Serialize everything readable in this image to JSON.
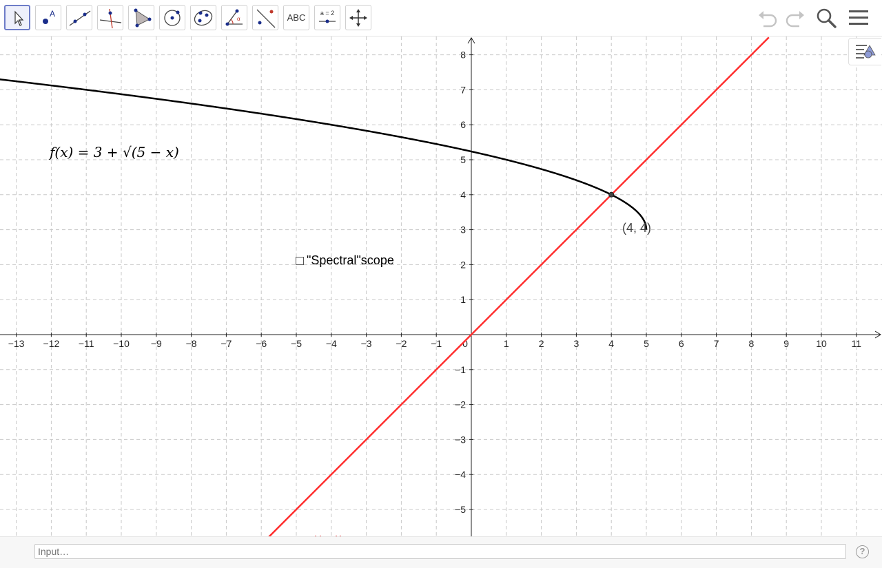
{
  "toolbar": {
    "tools": [
      {
        "name": "move",
        "icon": "cursor-arrow-icon"
      },
      {
        "name": "point",
        "icon": "point-icon"
      },
      {
        "name": "line",
        "icon": "line-through-two-points-icon"
      },
      {
        "name": "perpendicular",
        "icon": "perpendicular-line-icon"
      },
      {
        "name": "polygon",
        "icon": "polygon-icon"
      },
      {
        "name": "circle",
        "icon": "circle-center-point-icon"
      },
      {
        "name": "conic",
        "icon": "ellipse-icon"
      },
      {
        "name": "angle",
        "icon": "angle-icon"
      },
      {
        "name": "reflect",
        "icon": "reflect-about-line-icon"
      },
      {
        "name": "text",
        "label": "ABC"
      },
      {
        "name": "slider",
        "label": "a = 2"
      },
      {
        "name": "move-graphics",
        "icon": "move-view-icon"
      }
    ],
    "right_icons": [
      "undo-icon",
      "redo-icon",
      "search-icon",
      "menu-icon"
    ]
  },
  "graphics": {
    "x_ticks": [
      "−13",
      "−12",
      "−11",
      "−10",
      "−9",
      "−8",
      "−7",
      "−6",
      "−5",
      "−4",
      "−3",
      "−2",
      "−1",
      "0",
      "1",
      "2",
      "3",
      "4",
      "5",
      "6",
      "7",
      "8",
      "9",
      "10",
      "11"
    ],
    "y_ticks": [
      "−5",
      "−4",
      "−3",
      "−2",
      "−1",
      "1",
      "2",
      "3",
      "4",
      "5",
      "6",
      "7",
      "8"
    ],
    "function_label": "f(x) = 3 + √(5 − x)",
    "point_label": "(4, 4)",
    "line_label": "y = x",
    "checkbox_label": "\"Spectral\"scope",
    "colors": {
      "line": "#ff2d2d",
      "curve": "#000000",
      "grid": "#c8c8c8",
      "point": "#444444"
    }
  },
  "chart_data": {
    "type": "line",
    "title": "",
    "xlim": [
      -13.6,
      11.7
    ],
    "ylim": [
      -5.8,
      8.5
    ],
    "grid": true,
    "series": [
      {
        "name": "f(x) = 3 + √(5 − x)",
        "formula": "3+sqrt(5-x)",
        "domain": [
          -13.6,
          5
        ],
        "x": [
          -13.6,
          -10,
          -5,
          -1,
          0,
          2,
          4,
          4.5,
          5
        ],
        "values": [
          7.31,
          6.87,
          6.16,
          5.45,
          5.24,
          4.73,
          4.0,
          3.71,
          3.0
        ]
      },
      {
        "name": "y = x",
        "formula": "x",
        "x": [
          -5.8,
          8.5
        ],
        "values": [
          -5.8,
          8.5
        ]
      }
    ],
    "points": [
      {
        "label": "(4, 4)",
        "x": 4,
        "y": 4
      }
    ]
  },
  "bottom": {
    "input_placeholder": "Input…",
    "help_label": "?"
  }
}
